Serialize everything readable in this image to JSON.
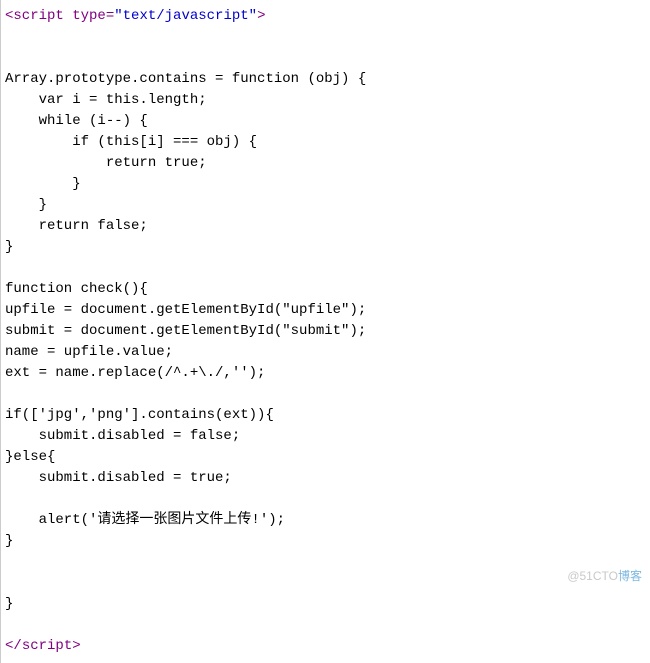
{
  "code": {
    "open_lt": "<",
    "open_tag": "script ",
    "attr_name": "type",
    "eq": "=",
    "attr_val": "\"text/javascript\"",
    "open_gt": ">",
    "body": "\n\n\nArray.prototype.contains = function (obj) {\n    var i = this.length;\n    while (i--) {\n        if (this[i] === obj) {\n            return true;\n        }\n    }\n    return false;\n}\n\nfunction check(){\nupfile = document.getElementById(\"upfile\");\nsubmit = document.getElementById(\"submit\");\nname = upfile.value;\next = name.replace(/^.+\\./,'');\n\nif(['jpg','png'].contains(ext)){\n    submit.disabled = false;\n}else{\n    submit.disabled = true;\n\n    alert('请选择一张图片文件上传!');\n}\n\n\n}\n\n",
    "close_lt": "</",
    "close_tag": "script",
    "close_gt": ">"
  },
  "watermark": {
    "text": "@51CTO",
    "brand": "博客"
  }
}
